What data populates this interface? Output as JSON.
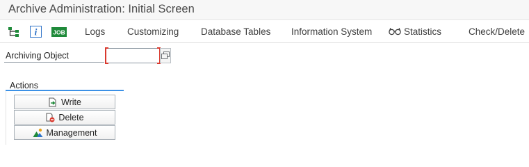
{
  "window": {
    "title": "Archive Administration: Initial Screen"
  },
  "toolbar": {
    "icons": [
      {
        "name": "hierarchy-icon"
      },
      {
        "name": "info-icon"
      },
      {
        "name": "job-icon",
        "text": "JOB"
      }
    ],
    "menu": [
      {
        "label": "Logs"
      },
      {
        "label": "Customizing"
      },
      {
        "label": "Database Tables"
      },
      {
        "label": "Information System"
      },
      {
        "label": "Statistics",
        "icon": "glasses-icon"
      },
      {
        "label": "Check/Delete"
      }
    ]
  },
  "form": {
    "archiving_object_label": "Archiving Object",
    "archiving_object_value": ""
  },
  "actions": {
    "title": "Actions",
    "buttons": [
      {
        "label": "Write",
        "icon": "write-icon"
      },
      {
        "label": "Delete",
        "icon": "delete-icon"
      },
      {
        "label": "Management",
        "icon": "management-icon"
      }
    ]
  },
  "colors": {
    "accent_blue": "#3c91e6",
    "required_red": "#d9392e",
    "job_green": "#1f8a3a"
  }
}
